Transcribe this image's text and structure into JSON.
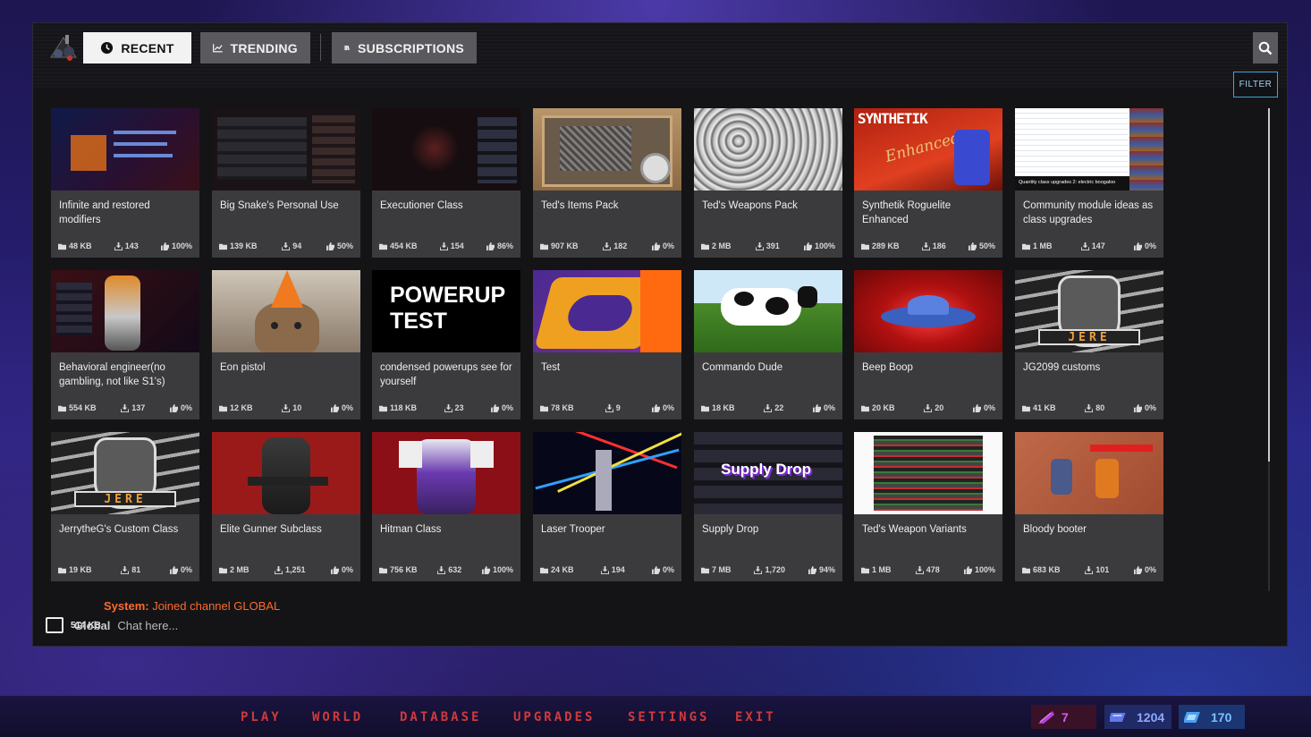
{
  "tabs": [
    {
      "label": "RECENT",
      "icon": "clock-icon",
      "active": true
    },
    {
      "label": "TRENDING",
      "icon": "trending-chart-icon",
      "active": false
    },
    {
      "label": "SUBSCRIPTIONS",
      "icon": "books-icon",
      "active": false
    }
  ],
  "filter_label": "FILTER",
  "cards": [
    {
      "title": "Infinite and restored modifiers",
      "size": "48 KB",
      "downloads": "143",
      "rating": "100%",
      "thumb": "ui-dark-blue"
    },
    {
      "title": "Big Snake's Personal Use",
      "size": "139 KB",
      "downloads": "94",
      "rating": "50%",
      "thumb": "ui-dark-red"
    },
    {
      "title": "Executioner Class",
      "size": "454 KB",
      "downloads": "154",
      "rating": "86%",
      "thumb": "ui-dark-red2"
    },
    {
      "title": "Ted's Items Pack",
      "size": "907 KB",
      "downloads": "182",
      "rating": "0%",
      "thumb": "box-photo"
    },
    {
      "title": "Ted's Weapons Pack",
      "size": "2 MB",
      "downloads": "391",
      "rating": "100%",
      "thumb": "bullets-photo"
    },
    {
      "title": "Synthetik Roguelite Enhanced",
      "size": "289 KB",
      "downloads": "186",
      "rating": "50%",
      "thumb": "synthetik"
    },
    {
      "title": "Community module ideas as class upgrades",
      "size": "1 MB",
      "downloads": "147",
      "rating": "0%",
      "thumb": "spreadsheet"
    },
    {
      "title": "Behavioral engineer(no gambling, not like S1's)",
      "size": "554 KB",
      "downloads": "137",
      "rating": "0%",
      "thumb": "robot-orange"
    },
    {
      "title": "Eon pistol",
      "size": "12 KB",
      "downloads": "10",
      "rating": "0%",
      "thumb": "cat-cone"
    },
    {
      "title": "condensed powerups see for yourself",
      "size": "118 KB",
      "downloads": "23",
      "rating": "0%",
      "thumb": "powerup-text"
    },
    {
      "title": "Test",
      "size": "78 KB",
      "downloads": "9",
      "rating": "0%",
      "thumb": "orange-logo"
    },
    {
      "title": "Commando Dude",
      "size": "18 KB",
      "downloads": "22",
      "rating": "0%",
      "thumb": "cow"
    },
    {
      "title": "Beep Boop",
      "size": "20 KB",
      "downloads": "20",
      "rating": "0%",
      "thumb": "ufo"
    },
    {
      "title": "JG2099 customs",
      "size": "41 KB",
      "downloads": "80",
      "rating": "0%",
      "thumb": "jere-logo"
    },
    {
      "title": "JerrytheG's Custom Class",
      "size": "19 KB",
      "downloads": "81",
      "rating": "0%",
      "thumb": "jere-logo"
    },
    {
      "title": "Elite Gunner Subclass",
      "size": "2 MB",
      "downloads": "1,251",
      "rating": "0%",
      "thumb": "gunner-red"
    },
    {
      "title": "Hitman Class",
      "size": "756 KB",
      "downloads": "632",
      "rating": "100%",
      "thumb": "purple-robot"
    },
    {
      "title": "Laser Trooper",
      "size": "24 KB",
      "downloads": "194",
      "rating": "0%",
      "thumb": "lasers"
    },
    {
      "title": "Supply Drop",
      "size": "7 MB",
      "downloads": "1,720",
      "rating": "94%",
      "thumb": "supply-drop"
    },
    {
      "title": "Ted's Weapon Variants",
      "size": "1 MB",
      "downloads": "478",
      "rating": "100%",
      "thumb": "disks"
    },
    {
      "title": "Bloody booter",
      "size": "683 KB",
      "downloads": "101",
      "rating": "0%",
      "thumb": "game-scene"
    }
  ],
  "thumb_texts": {
    "synthetik": "SYNTHETIK",
    "synthetik_sub": "Enhanced",
    "spreadsheet_caption": "Quantity class upgrades 2: electric boogaloo",
    "powerup": "POWERUP TEST",
    "jere": "JERE",
    "supply": "Supply Drop"
  },
  "chat": {
    "system_prefix": "System:",
    "system_message": " Joined channel GLOBAL",
    "size": "514 KB",
    "channel": "Global",
    "placeholder": "Chat here..."
  },
  "menu": [
    "PLAY",
    "WORLD",
    "DATABASE",
    "UPGRADES",
    "SETTINGS",
    "EXIT"
  ],
  "currencies": [
    {
      "icon": "feather-token-icon",
      "value": "7",
      "color": "#d35bff",
      "bg": "#4a1430"
    },
    {
      "icon": "blue-chip-icon",
      "value": "1204",
      "color": "#7d9cff",
      "bg": "#23306a"
    },
    {
      "icon": "cyan-chip-icon",
      "value": "170",
      "color": "#6fb8ff",
      "bg": "#1e3a78"
    }
  ]
}
